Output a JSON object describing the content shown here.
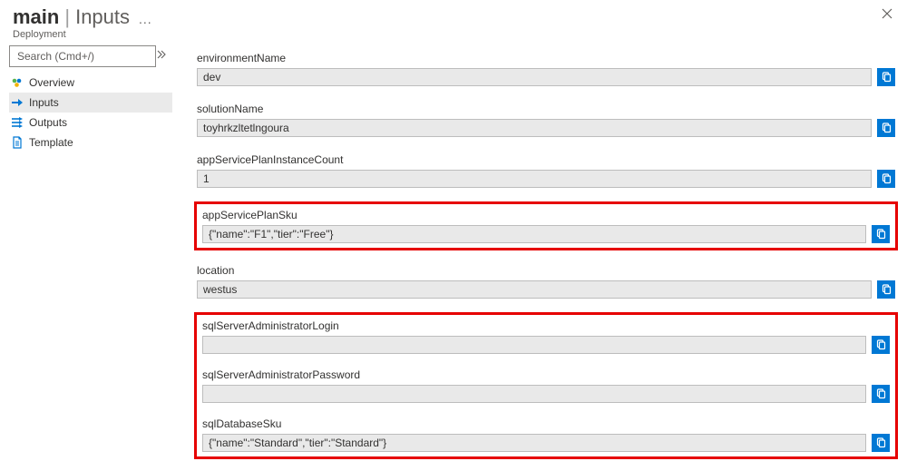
{
  "header": {
    "title_main": "main",
    "title_sep": "|",
    "title_sub": "Inputs",
    "more_label": "...",
    "subtitle": "Deployment"
  },
  "search": {
    "placeholder": "Search (Cmd+/)"
  },
  "nav": {
    "items": [
      {
        "key": "overview",
        "label": "Overview"
      },
      {
        "key": "inputs",
        "label": "Inputs"
      },
      {
        "key": "outputs",
        "label": "Outputs"
      },
      {
        "key": "template",
        "label": "Template"
      }
    ]
  },
  "fields": {
    "single": [
      {
        "key": "environmentName",
        "label": "environmentName",
        "value": "dev"
      },
      {
        "key": "solutionName",
        "label": "solutionName",
        "value": "toyhrkzltetlngoura"
      },
      {
        "key": "appServicePlanInstanceCount",
        "label": "appServicePlanInstanceCount",
        "value": "1"
      }
    ],
    "hl1": [
      {
        "key": "appServicePlanSku",
        "label": "appServicePlanSku",
        "value": "{\"name\":\"F1\",\"tier\":\"Free\"}"
      }
    ],
    "mid": [
      {
        "key": "location",
        "label": "location",
        "value": "westus"
      }
    ],
    "hl2": [
      {
        "key": "sqlServerAdministratorLogin",
        "label": "sqlServerAdministratorLogin",
        "value": ""
      },
      {
        "key": "sqlServerAdministratorPassword",
        "label": "sqlServerAdministratorPassword",
        "value": ""
      },
      {
        "key": "sqlDatabaseSku",
        "label": "sqlDatabaseSku",
        "value": "{\"name\":\"Standard\",\"tier\":\"Standard\"}"
      }
    ]
  },
  "colors": {
    "accent": "#0078d4",
    "highlight_border": "#e60000",
    "input_bg": "#e9e9e9"
  }
}
